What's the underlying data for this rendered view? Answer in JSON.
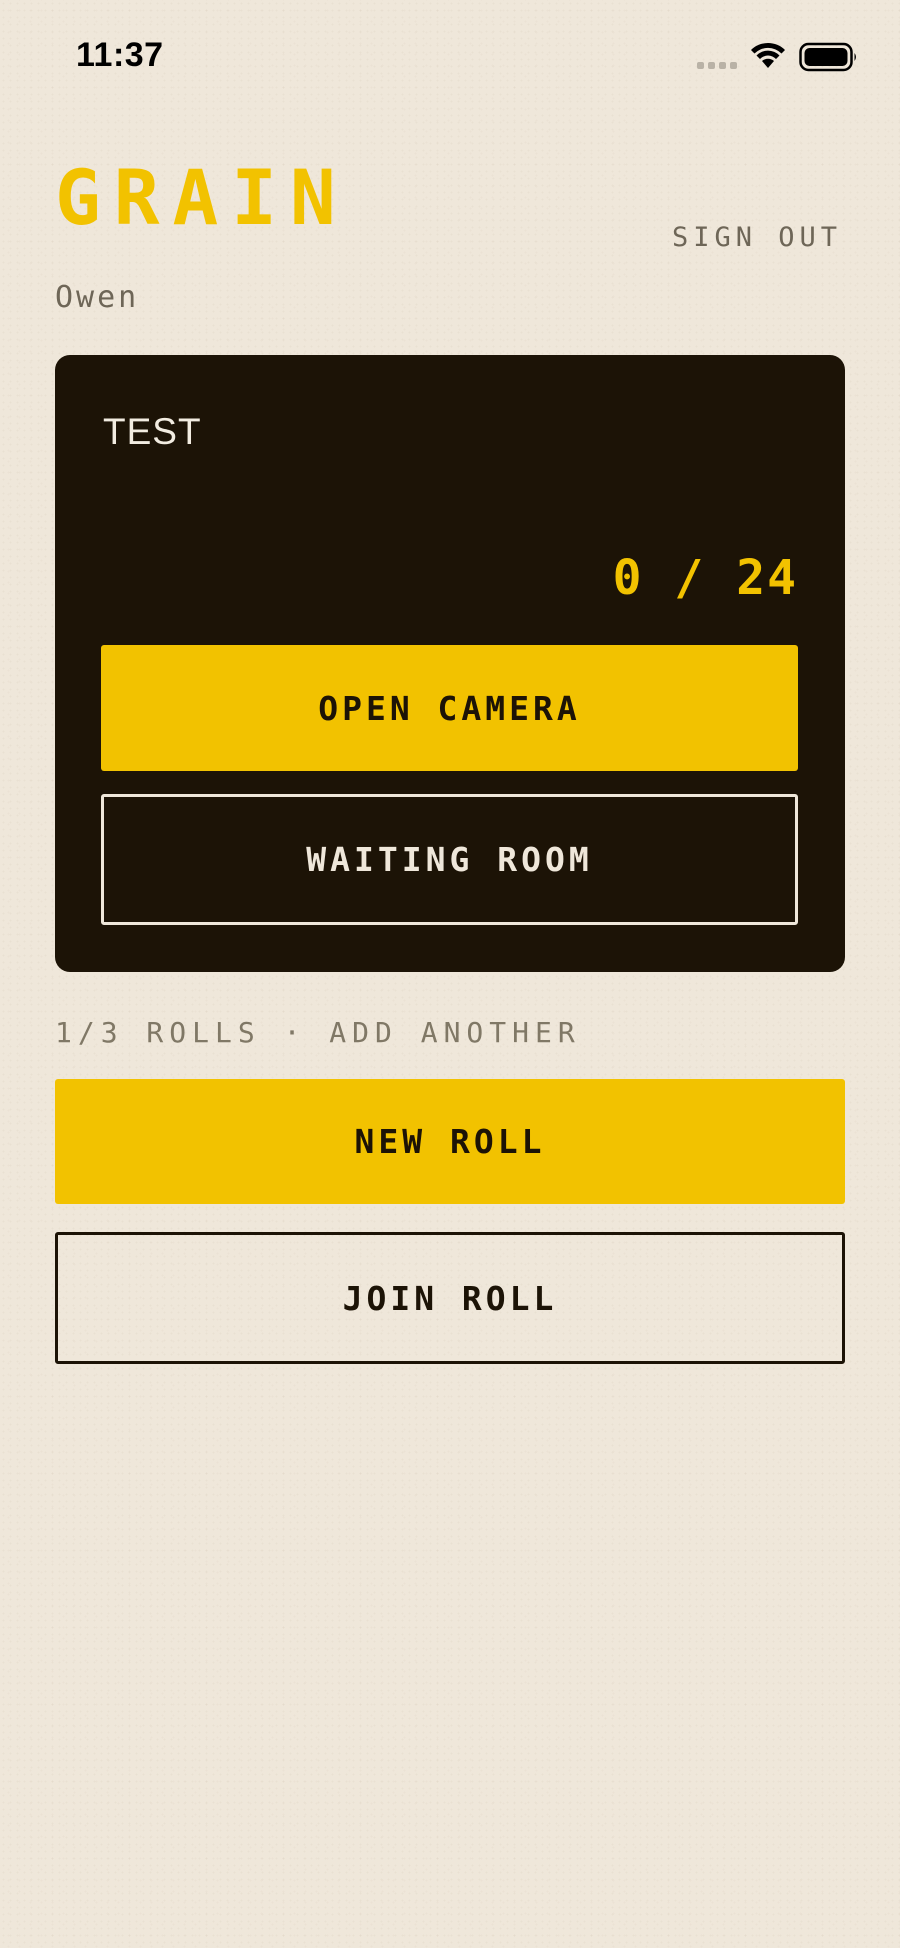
{
  "status_bar": {
    "time": "11:37",
    "icons": [
      "signal-icon",
      "wifi-icon",
      "battery-icon"
    ]
  },
  "header": {
    "app_title": "GRAIN",
    "sign_out_label": "SIGN OUT",
    "user_name": "Owen"
  },
  "active_roll": {
    "name": "TEST",
    "exposure_count": "0 / 24",
    "open_camera_label": "OPEN CAMERA",
    "waiting_room_label": "WAITING ROOM"
  },
  "rolls": {
    "count_text": "1/3 ROLLS · ADD ANOTHER",
    "new_roll_label": "NEW ROLL",
    "join_roll_label": "JOIN ROLL"
  },
  "colors": {
    "background": "#efe7da",
    "accent": "#f2c200",
    "card": "#1c1306",
    "muted_text": "#6e6657"
  }
}
